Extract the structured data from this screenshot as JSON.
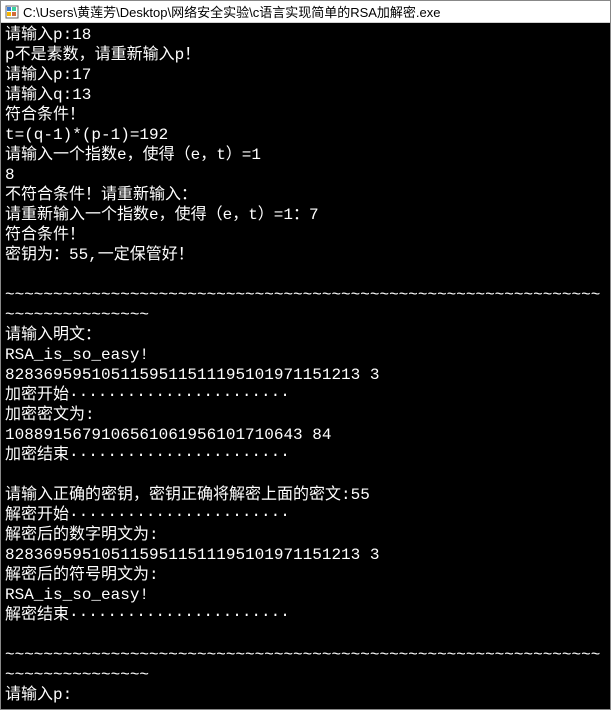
{
  "window": {
    "title": "C:\\Users\\黄莲芳\\Desktop\\网络安全实验\\c语言实现简单的RSA加解密.exe"
  },
  "lines": [
    "请输入p:18",
    "p不是素数，请重新输入p！",
    "请输入p:17",
    "请输入q:13",
    "符合条件！",
    "t=(q-1)*(p-1)=192",
    "请输入一个指数e，使得（e，t）=1",
    "8",
    "不符合条件！请重新输入：",
    "请重新输入一个指数e，使得（e，t）=1：7",
    "符合条件！",
    "密钥为：55,一定保管好！",
    "",
    "~~~~~~~~~~~~~~~~~~~~~~~~~~~~~~~~~~~~~~~~~~~~~~~~~~~~~~~~~~~~~~~~~~~~~~~~~~~~~",
    "请输入明文：",
    "RSA_is_so_easy!",
    "8283695951051159511511195101971151213 3",
    "加密开始·······················",
    "加密密文为:",
    "1088915679106561061956101710643 84",
    "加密结束·······················",
    "",
    "请输入正确的密钥，密钥正确将解密上面的密文:55",
    "解密开始·······················",
    "解密后的数字明文为:",
    "8283695951051159511511195101971151213 3",
    "解密后的符号明文为:",
    "RSA_is_so_easy!",
    "解密结束·······················",
    "",
    "~~~~~~~~~~~~~~~~~~~~~~~~~~~~~~~~~~~~~~~~~~~~~~~~~~~~~~~~~~~~~~~~~~~~~~~~~~~~~",
    "请输入p:"
  ]
}
